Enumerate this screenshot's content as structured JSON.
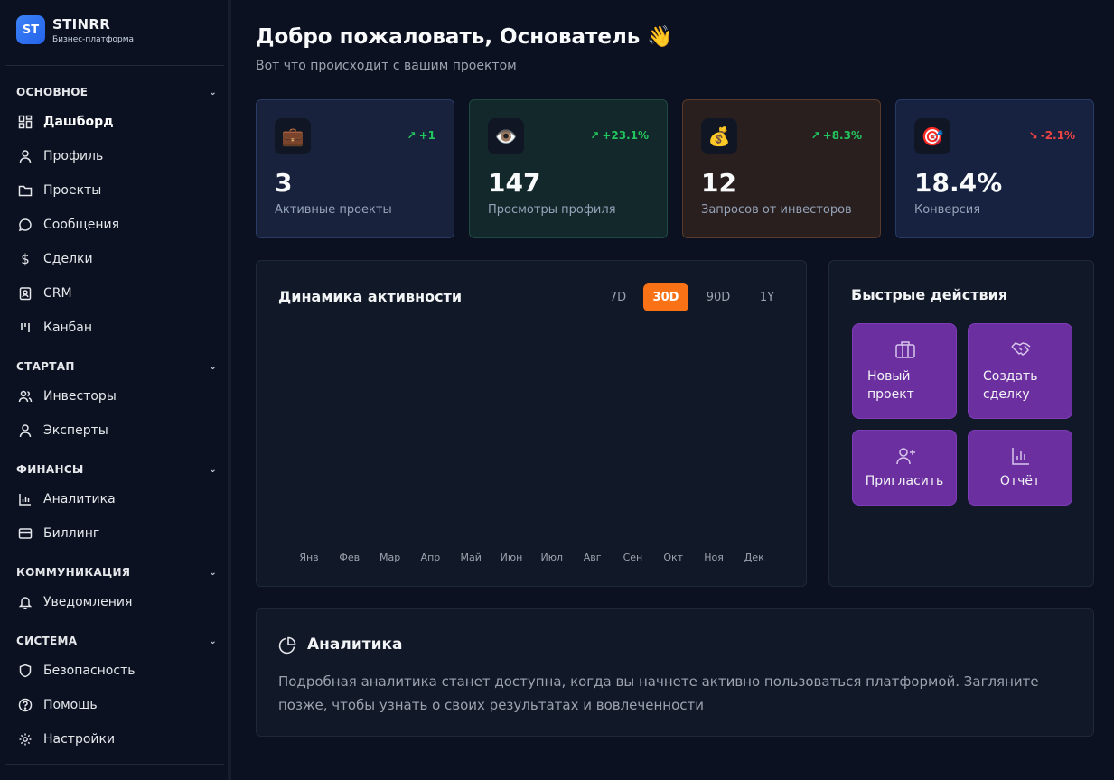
{
  "brand": {
    "logo": "ST",
    "name": "STINRR",
    "subtitle": "Бизнес-платформа"
  },
  "sidebar": {
    "sections": [
      {
        "title": "ОСНОВНОЕ",
        "items": [
          {
            "label": "Дашборд",
            "icon": "dashboard-icon",
            "active": true
          },
          {
            "label": "Профиль",
            "icon": "user-icon"
          },
          {
            "label": "Проекты",
            "icon": "folder-icon"
          },
          {
            "label": "Сообщения",
            "icon": "chat-icon"
          },
          {
            "label": "Сделки",
            "icon": "dollar-icon"
          },
          {
            "label": "CRM",
            "icon": "contact-card-icon"
          },
          {
            "label": "Канбан",
            "icon": "kanban-icon"
          }
        ]
      },
      {
        "title": "СТАРТАП",
        "items": [
          {
            "label": "Инвесторы",
            "icon": "users-icon"
          },
          {
            "label": "Эксперты",
            "icon": "user-icon"
          }
        ]
      },
      {
        "title": "ФИНАНСЫ",
        "items": [
          {
            "label": "Аналитика",
            "icon": "bar-chart-icon"
          },
          {
            "label": "Биллинг",
            "icon": "credit-card-icon"
          }
        ]
      },
      {
        "title": "КОММУНИКАЦИЯ",
        "items": [
          {
            "label": "Уведомления",
            "icon": "bell-icon"
          }
        ]
      },
      {
        "title": "СИСТЕМА",
        "items": [
          {
            "label": "Безопасность",
            "icon": "shield-icon"
          },
          {
            "label": "Помощь",
            "icon": "help-circle-icon"
          },
          {
            "label": "Настройки",
            "icon": "gear-icon"
          }
        ]
      }
    ]
  },
  "header": {
    "title": "Добро пожаловать, Основатель 👋",
    "subtitle": "Вот что происходит с вашим проектом"
  },
  "stats": [
    {
      "icon": "💼",
      "icon_name": "briefcase-icon",
      "trend": "+1",
      "direction": "up",
      "value": "3",
      "label": "Активные проекты",
      "bg": "#18223d",
      "border": "#2a3a63"
    },
    {
      "icon": "👁️",
      "icon_name": "eye-icon",
      "trend": "+23.1%",
      "direction": "up",
      "value": "147",
      "label": "Просмотры профиля",
      "bg": "#12282a",
      "border": "#1f4a3f"
    },
    {
      "icon": "💰",
      "icon_name": "money-bag-icon",
      "trend": "+8.3%",
      "direction": "up",
      "value": "12",
      "label": "Запросов от инвесторов",
      "bg": "#2a1f1f",
      "border": "#5a3a2a"
    },
    {
      "icon": "🎯",
      "icon_name": "target-icon",
      "trend": "-2.1%",
      "direction": "down",
      "value": "18.4%",
      "label": "Конверсия",
      "bg": "#172240",
      "border": "#263a66"
    }
  ],
  "activity": {
    "title": "Динамика активности",
    "ranges": [
      "7D",
      "30D",
      "90D",
      "1Y"
    ],
    "active_range": "30D",
    "months": [
      "Янв",
      "Фев",
      "Мар",
      "Апр",
      "Май",
      "Июн",
      "Июл",
      "Авг",
      "Сен",
      "Окт",
      "Ноя",
      "Дек"
    ]
  },
  "quick_actions": {
    "title": "Быстрые действия",
    "items": [
      {
        "label": "Новый проект",
        "icon": "briefcase-icon"
      },
      {
        "label": "Создать сделку",
        "icon": "handshake-icon"
      },
      {
        "label": "Пригласить",
        "icon": "user-plus-icon"
      },
      {
        "label": "Отчёт",
        "icon": "bar-chart-icon"
      }
    ]
  },
  "analytics": {
    "title": "Аналитика",
    "text": "Подробная аналитика станет доступна, когда вы начнете активно пользоваться платформой. Загляните позже, чтобы узнать о своих результатах и вовлеченности"
  },
  "colors": {
    "accent": "#f97316",
    "purple": "#6b2fa0",
    "up": "#22c55e",
    "down": "#ef4444"
  }
}
